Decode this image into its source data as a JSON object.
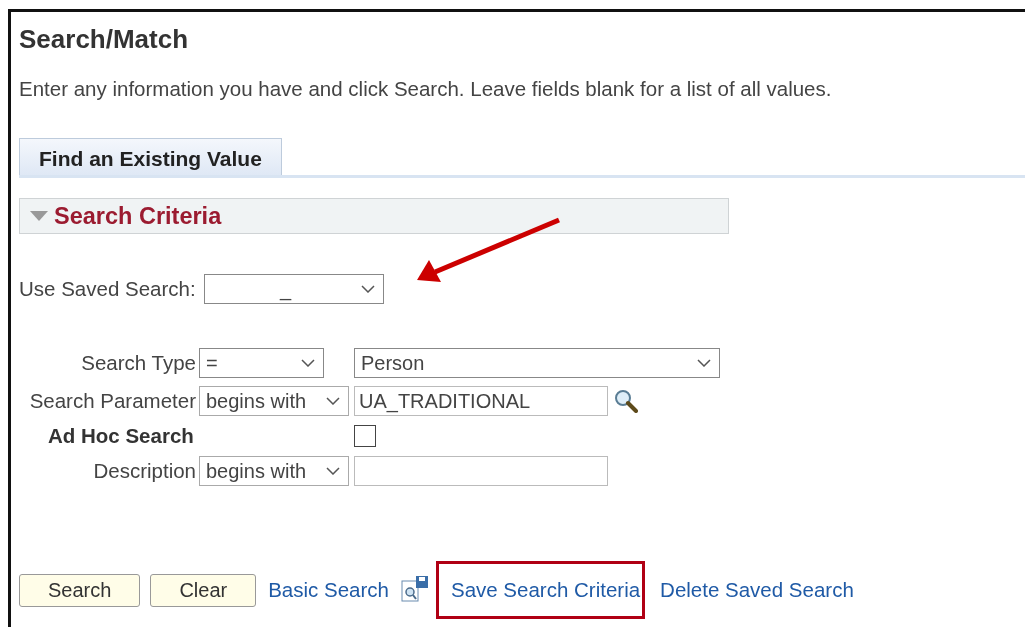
{
  "page": {
    "title": "Search/Match",
    "instructions": "Enter any information you have and click Search. Leave fields blank for a list of all values."
  },
  "tabs": [
    {
      "label": "Find an Existing Value",
      "selected": true
    }
  ],
  "section": {
    "title": "Search Criteria",
    "expanded": true
  },
  "saved_search": {
    "label": "Use Saved Search:",
    "value": "_",
    "pointed_at": true
  },
  "criteria": [
    {
      "label": "Search Type",
      "bold": false,
      "kind": "select",
      "operator": "=",
      "value": "Person"
    },
    {
      "label": "Search Parameter",
      "bold": false,
      "kind": "text",
      "operator": "begins with",
      "value": "UA_TRADITIONAL",
      "lookup": true
    },
    {
      "label": "Ad Hoc Search",
      "bold": true,
      "kind": "checkbox",
      "checked": false
    },
    {
      "label": "Description",
      "bold": false,
      "kind": "text",
      "operator": "begins with",
      "lookup": false
    }
  ],
  "buttons": [
    "Search",
    "Clear"
  ],
  "links": [
    {
      "kind": "link",
      "label": "Basic Search",
      "highlighted": false
    },
    {
      "kind": "icon"
    },
    {
      "kind": "link",
      "label": "Save Search Criteria",
      "highlighted": true
    },
    {
      "kind": "link",
      "label": "Delete Saved Search",
      "highlighted": false
    }
  ]
}
